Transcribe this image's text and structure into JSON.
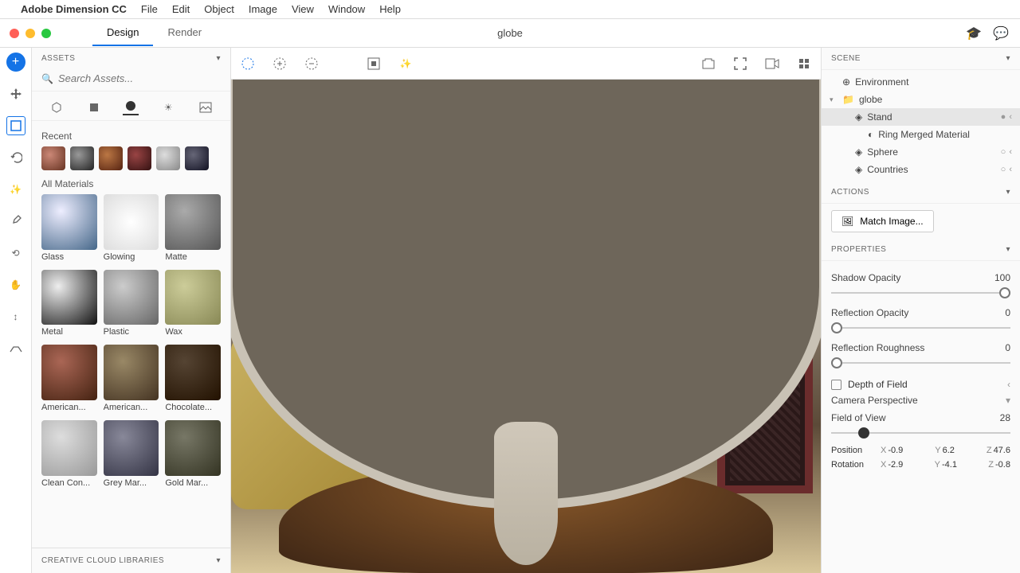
{
  "menubar": {
    "app": "Adobe Dimension CC",
    "items": [
      "File",
      "Edit",
      "Object",
      "Image",
      "View",
      "Window",
      "Help"
    ]
  },
  "tabs": {
    "design": "Design",
    "render": "Render"
  },
  "doc_title": "globe",
  "assets": {
    "header": "ASSETS",
    "search_placeholder": "Search Assets...",
    "recent_label": "Recent",
    "all_label": "All Materials",
    "materials": [
      "Glass",
      "Glowing",
      "Matte",
      "Metal",
      "Plastic",
      "Wax",
      "American...",
      "American...",
      "Chocolate...",
      "Clean Con...",
      "Grey Mar...",
      "Gold Mar..."
    ],
    "cc_label": "CREATIVE CLOUD LIBRARIES"
  },
  "scene": {
    "header": "SCENE",
    "items": {
      "env": "Environment",
      "globe": "globe",
      "stand": "Stand",
      "ring": "Ring Merged Material",
      "sphere": "Sphere",
      "countries": "Countries"
    }
  },
  "actions": {
    "header": "ACTIONS",
    "match": "Match Image..."
  },
  "props": {
    "header": "PROPERTIES",
    "shadow_opacity": {
      "label": "Shadow Opacity",
      "value": "100"
    },
    "reflection_opacity": {
      "label": "Reflection Opacity",
      "value": "0"
    },
    "reflection_roughness": {
      "label": "Reflection Roughness",
      "value": "0"
    },
    "dof": "Depth of Field",
    "camera": "Camera Perspective",
    "fov": {
      "label": "Field of View",
      "value": "28"
    },
    "position": {
      "label": "Position",
      "x": "-0.9",
      "y": "6.2",
      "z": "47.6"
    },
    "rotation": {
      "label": "Rotation",
      "x": "-2.9",
      "y": "-4.1",
      "z": "-0.8"
    }
  }
}
